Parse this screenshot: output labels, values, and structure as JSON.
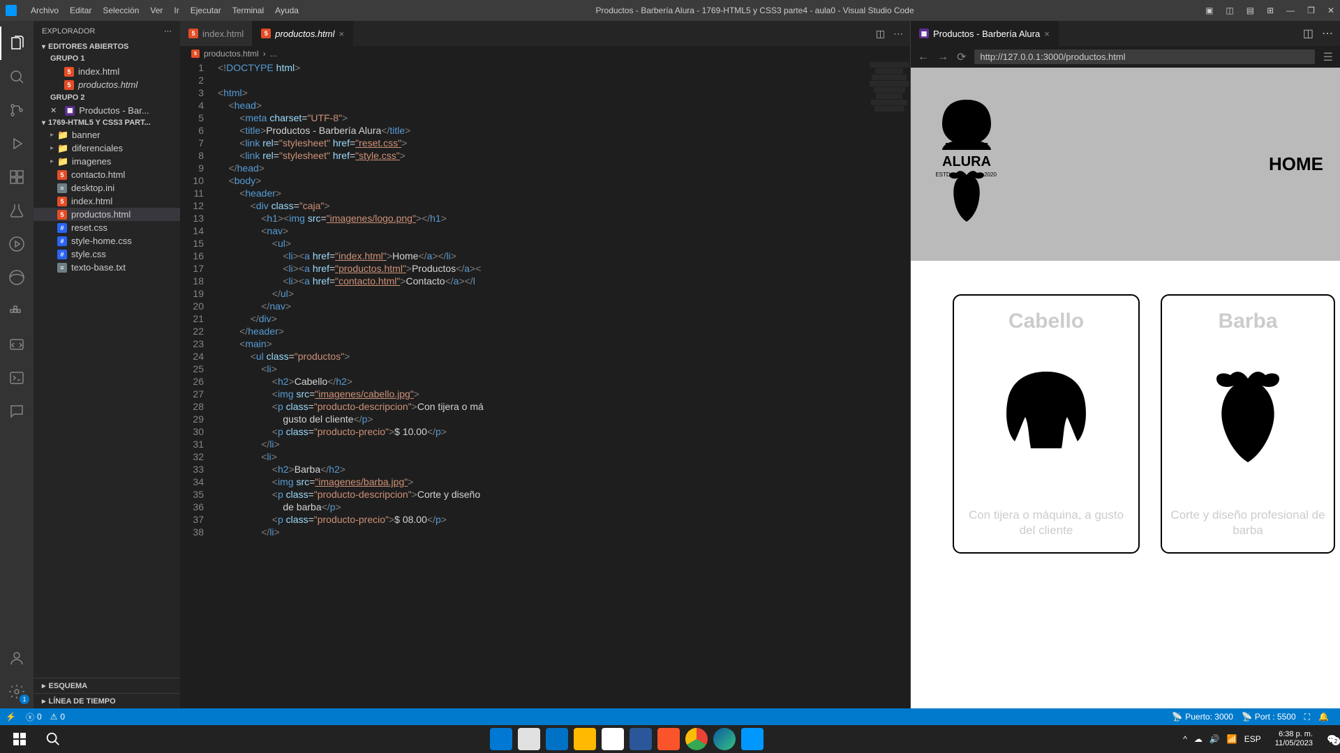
{
  "titlebar": {
    "menus": [
      "Archivo",
      "Editar",
      "Selección",
      "Ver",
      "Ir",
      "Ejecutar",
      "Terminal",
      "Ayuda"
    ],
    "title": "Productos - Barbería Alura - 1769-HTML5 y CSS3 parte4 - aula0 - Visual Studio Code"
  },
  "sidebar": {
    "header": "EXPLORADOR",
    "sections": {
      "open_editors": "EDITORES ABIERTOS",
      "group1": "GRUPO 1",
      "group2": "GRUPO 2",
      "workspace": "1769-HTML5 Y CSS3 PART...",
      "outline": "ESQUEMA",
      "timeline": "LÍNEA DE TIEMPO"
    },
    "open_editors": {
      "g1": [
        "index.html",
        "productos.html"
      ],
      "g2": [
        "Productos - Bar..."
      ]
    },
    "files": [
      {
        "name": "banner",
        "type": "folder"
      },
      {
        "name": "diferenciales",
        "type": "folder"
      },
      {
        "name": "imagenes",
        "type": "folder"
      },
      {
        "name": "contacto.html",
        "type": "html"
      },
      {
        "name": "desktop.ini",
        "type": "cfg"
      },
      {
        "name": "index.html",
        "type": "html"
      },
      {
        "name": "productos.html",
        "type": "html",
        "selected": true
      },
      {
        "name": "reset.css",
        "type": "css"
      },
      {
        "name": "style-home.css",
        "type": "css"
      },
      {
        "name": "style.css",
        "type": "css"
      },
      {
        "name": "texto-base.txt",
        "type": "txt"
      }
    ]
  },
  "editor": {
    "tabs": [
      {
        "name": "index.html",
        "active": false
      },
      {
        "name": "productos.html",
        "active": true
      }
    ],
    "breadcrumb": [
      "productos.html",
      "..."
    ],
    "lines_count": 38
  },
  "preview": {
    "tab_title": "Productos - Barbería Alura",
    "url": "http://127.0.0.1:3000/productos.html",
    "nav_link": "HOME",
    "product1": {
      "title": "Cabello",
      "desc": "Con tijera o máquina, a gusto del cliente"
    },
    "product2": {
      "title": "Barba",
      "desc": "Corte y diseño profesional de barba"
    },
    "logo_text": {
      "brand": "ALURA",
      "left": "ESTD",
      "right": "2020"
    }
  },
  "statusbar": {
    "errors": "0",
    "warnings": "0",
    "port1": "Puerto: 3000",
    "port2": "Port : 5500"
  },
  "taskbar": {
    "lang": "ESP",
    "time": "6:38 p. m.",
    "date": "11/05/2023",
    "notif": "2"
  }
}
